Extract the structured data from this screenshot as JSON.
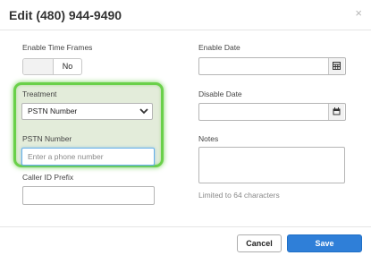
{
  "dialog": {
    "title": "Edit (480) 944-9490",
    "close_glyph": "×"
  },
  "left": {
    "enable_time_frames_label": "Enable Time Frames",
    "toggle_value": "No",
    "treatment_label": "Treatment",
    "treatment_selected": "PSTN Number",
    "pstn_number_label": "PSTN Number",
    "pstn_number_placeholder": "Enter a phone number",
    "pstn_number_value": "",
    "caller_id_prefix_label": "Caller ID Prefix",
    "caller_id_prefix_value": ""
  },
  "right": {
    "enable_date_label": "Enable Date",
    "enable_date_value": "",
    "disable_date_label": "Disable Date",
    "disable_date_value": "",
    "notes_label": "Notes",
    "notes_value": "",
    "notes_hint": "Limited to 64 characters"
  },
  "footer": {
    "cancel_label": "Cancel",
    "save_label": "Save"
  },
  "colors": {
    "highlight": "#6ad04a",
    "save_button": "#2f7fd8",
    "focus_ring": "#66afe9"
  },
  "icons": [
    "close-icon",
    "chevron-down-icon",
    "calendar-grid-icon",
    "calendar-icon"
  ]
}
